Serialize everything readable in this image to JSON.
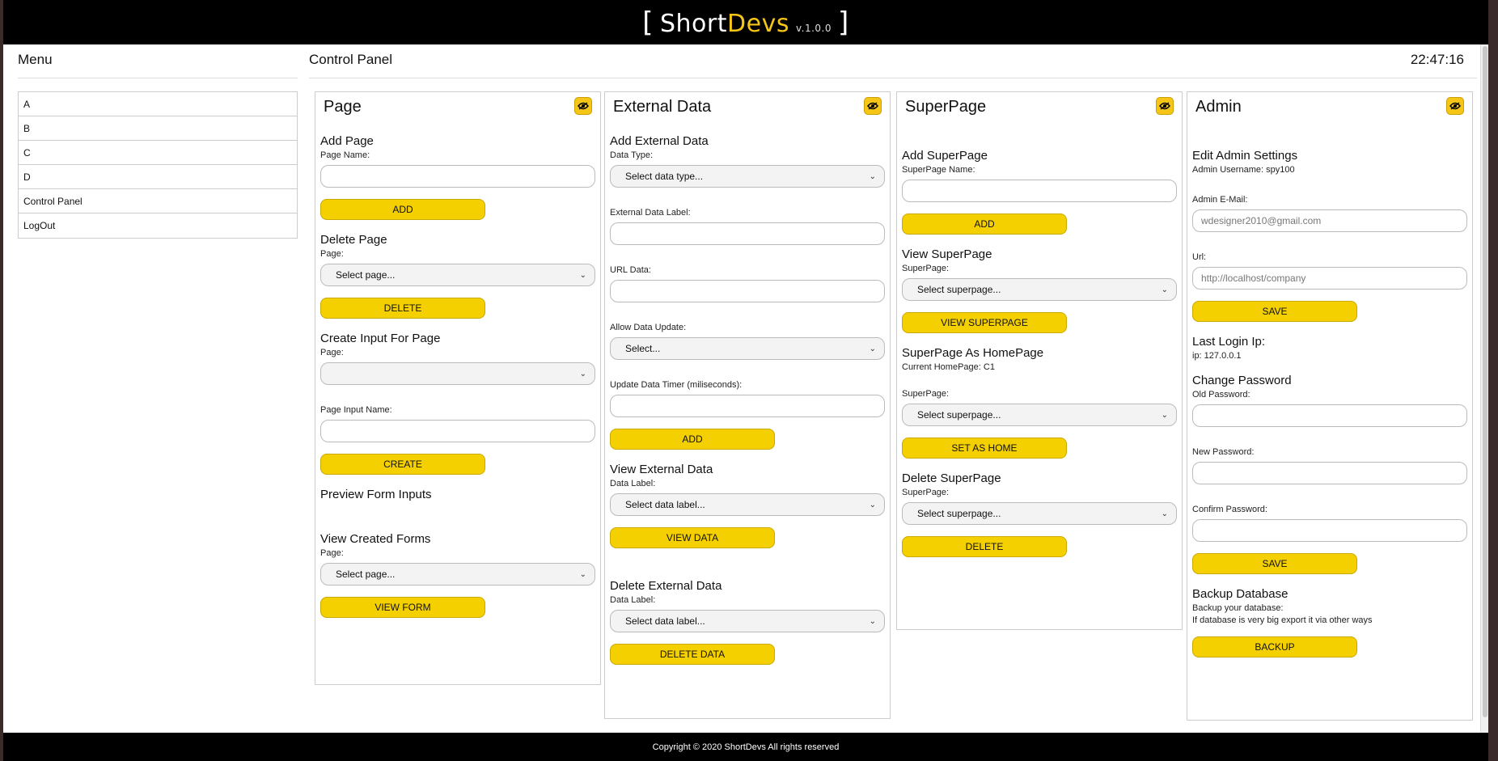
{
  "brand": {
    "bracket_open": "[",
    "short": "Short",
    "devs": "Devs",
    "version": "v.1.0.0",
    "bracket_close": "]"
  },
  "menu": {
    "title": "Menu",
    "items": [
      "A",
      "B",
      "C",
      "D",
      "Control Panel",
      "LogOut"
    ]
  },
  "control": {
    "title": "Control Panel",
    "clock": "22:47:16"
  },
  "page_panel": {
    "title": "Page",
    "add_title": "Add Page",
    "page_name_label": "Page Name:",
    "add_btn": "ADD",
    "delete_title": "Delete Page",
    "page_label": "Page:",
    "select_page": "Select page...",
    "delete_btn": "DELETE",
    "create_input_title": "Create Input For Page",
    "page_label2": "Page:",
    "page_input_name_label": "Page Input Name:",
    "create_btn": "CREATE",
    "preview_title": "Preview Form Inputs",
    "view_forms_title": "View Created Forms",
    "page_label3": "Page:",
    "select_page2": "Select page...",
    "view_form_btn": "VIEW FORM"
  },
  "external_panel": {
    "title": "External Data",
    "add_title": "Add External Data",
    "data_type_label": "Data Type:",
    "select_data_type": "Select data type...",
    "label_label": "External Data Label:",
    "url_label": "URL Data:",
    "allow_update_label": "Allow Data Update:",
    "select_generic": "Select...",
    "timer_label": "Update Data Timer (miliseconds):",
    "add_btn": "ADD",
    "view_title": "View External Data",
    "data_label_label": "Data Label:",
    "select_data_label": "Select data label...",
    "view_btn": "VIEW DATA",
    "delete_title": "Delete External Data",
    "data_label_label2": "Data Label:",
    "select_data_label2": "Select data label...",
    "delete_btn": "DELETE DATA"
  },
  "super_panel": {
    "title": "SuperPage",
    "add_title": "Add SuperPage",
    "name_label": "SuperPage Name:",
    "add_btn": "ADD",
    "view_title": "View SuperPage",
    "sp_label": "SuperPage:",
    "select_sp": "Select superpage...",
    "view_btn": "VIEW SUPERPAGE",
    "home_title": "SuperPage As HomePage",
    "current_home": "Current HomePage: C1",
    "sp_label2": "SuperPage:",
    "select_sp2": "Select superpage...",
    "set_home_btn": "SET AS HOME",
    "delete_title": "Delete SuperPage",
    "sp_label3": "SuperPage:",
    "select_sp3": "Select superpage...",
    "delete_btn": "DELETE"
  },
  "admin_panel": {
    "title": "Admin",
    "edit_title": "Edit Admin Settings",
    "username_line": "Admin Username: spy100",
    "email_label": "Admin E-Mail:",
    "email_placeholder": "wdesigner2010@gmail.com",
    "url_label": "Url:",
    "url_placeholder": "http://localhost/company",
    "save_btn": "SAVE",
    "last_login_title": "Last Login Ip:",
    "ip_line": "ip: 127.0.0.1",
    "pw_title": "Change Password",
    "old_pw_label": "Old Password:",
    "new_pw_label": "New Password:",
    "confirm_pw_label": "Confirm Password:",
    "save_btn2": "SAVE",
    "backup_title": "Backup Database",
    "backup_line1": "Backup your database:",
    "backup_line2": "If database is very big export it via other ways",
    "backup_btn": "BACKUP"
  },
  "footer": {
    "text": "Copyright © 2020 ShortDevs All rights reserved"
  },
  "colors": {
    "accent": "#f5d000",
    "bar": "#000000"
  }
}
